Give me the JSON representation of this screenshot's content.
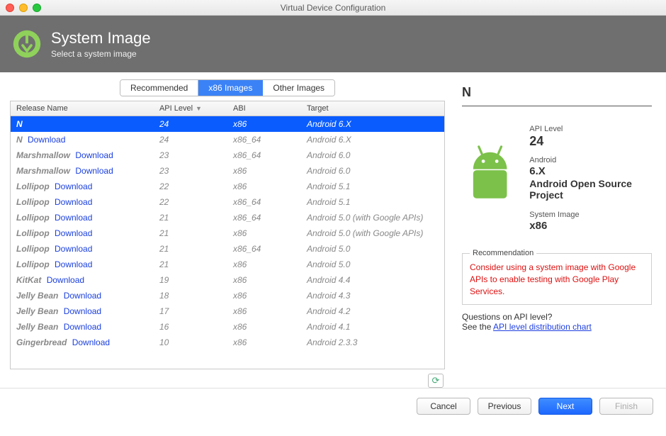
{
  "window": {
    "title": "Virtual Device Configuration"
  },
  "header": {
    "title": "System Image",
    "subtitle": "Select a system image"
  },
  "tabs": {
    "items": [
      "Recommended",
      "x86 Images",
      "Other Images"
    ],
    "selected_index": 1
  },
  "table": {
    "columns": [
      "Release Name",
      "API Level",
      "ABI",
      "Target"
    ],
    "sort_col": 1,
    "rows": [
      {
        "name": "N",
        "download": false,
        "api": "24",
        "abi": "x86",
        "target": "Android 6.X",
        "selected": true
      },
      {
        "name": "N",
        "download": true,
        "api": "24",
        "abi": "x86_64",
        "target": "Android 6.X"
      },
      {
        "name": "Marshmallow",
        "download": true,
        "api": "23",
        "abi": "x86_64",
        "target": "Android 6.0"
      },
      {
        "name": "Marshmallow",
        "download": true,
        "api": "23",
        "abi": "x86",
        "target": "Android 6.0"
      },
      {
        "name": "Lollipop",
        "download": true,
        "api": "22",
        "abi": "x86",
        "target": "Android 5.1"
      },
      {
        "name": "Lollipop",
        "download": true,
        "api": "22",
        "abi": "x86_64",
        "target": "Android 5.1"
      },
      {
        "name": "Lollipop",
        "download": true,
        "api": "21",
        "abi": "x86_64",
        "target": "Android 5.0 (with Google APIs)"
      },
      {
        "name": "Lollipop",
        "download": true,
        "api": "21",
        "abi": "x86",
        "target": "Android 5.0 (with Google APIs)"
      },
      {
        "name": "Lollipop",
        "download": true,
        "api": "21",
        "abi": "x86_64",
        "target": "Android 5.0"
      },
      {
        "name": "Lollipop",
        "download": true,
        "api": "21",
        "abi": "x86",
        "target": "Android 5.0"
      },
      {
        "name": "KitKat",
        "download": true,
        "api": "19",
        "abi": "x86",
        "target": "Android 4.4"
      },
      {
        "name": "Jelly Bean",
        "download": true,
        "api": "18",
        "abi": "x86",
        "target": "Android 4.3"
      },
      {
        "name": "Jelly Bean",
        "download": true,
        "api": "17",
        "abi": "x86",
        "target": "Android 4.2"
      },
      {
        "name": "Jelly Bean",
        "download": true,
        "api": "16",
        "abi": "x86",
        "target": "Android 4.1"
      },
      {
        "name": "Gingerbread",
        "download": true,
        "api": "10",
        "abi": "x86",
        "target": "Android 2.3.3"
      }
    ],
    "download_label": "Download"
  },
  "detail": {
    "title": "N",
    "api_label": "API Level",
    "api_value": "24",
    "android_label": "Android",
    "android_value_line1": "6.X",
    "android_value_line2": "Android Open Source Project",
    "sysimg_label": "System Image",
    "sysimg_value": "x86",
    "recommendation_legend": "Recommendation",
    "recommendation_text": "Consider using a system image with Google APIs to enable testing with Google Play Services.",
    "questions_label": "Questions on API level?",
    "questions_prefix": "See the ",
    "questions_link": "API level distribution chart"
  },
  "footer": {
    "cancel": "Cancel",
    "previous": "Previous",
    "next": "Next",
    "finish": "Finish"
  },
  "icons": {
    "refresh": "⟳",
    "sort_desc": "▼"
  }
}
